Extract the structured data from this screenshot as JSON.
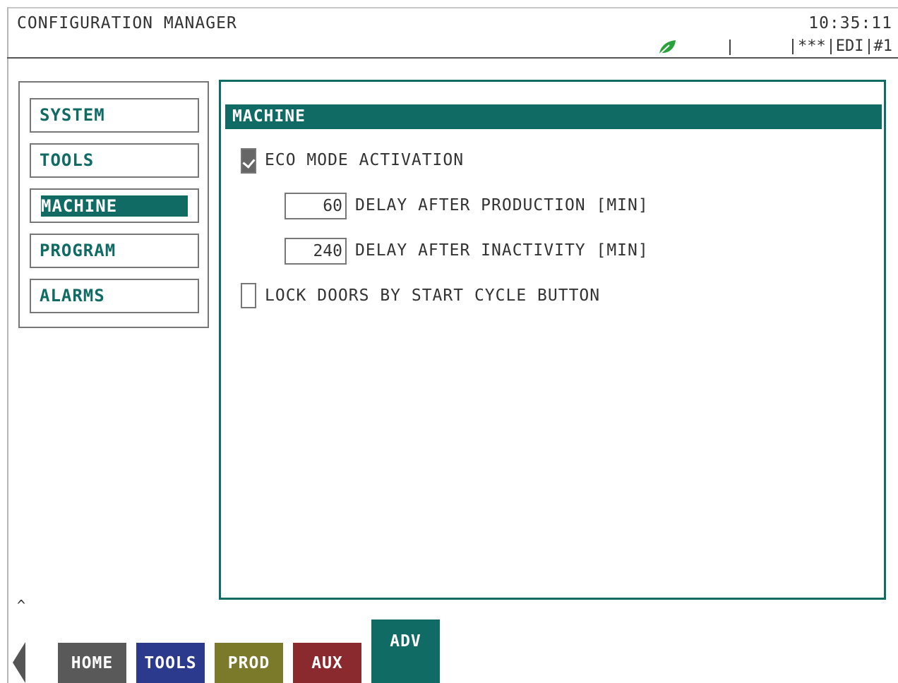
{
  "header": {
    "title": "CONFIGURATION MANAGER",
    "time": "10:35:11",
    "status": [
      "***",
      "EDI",
      "#1"
    ]
  },
  "icons": {
    "eco": "leaf-icon",
    "scroll_up": "caret-up-icon",
    "prev": "left-arrow-icon"
  },
  "sidebar": {
    "items": [
      {
        "label": "SYSTEM"
      },
      {
        "label": "TOOLS"
      },
      {
        "label": "MACHINE",
        "selected": true
      },
      {
        "label": "PROGRAM"
      },
      {
        "label": "ALARMS"
      }
    ]
  },
  "main": {
    "title": "MACHINE",
    "eco_mode": {
      "label": "ECO MODE ACTIVATION",
      "checked": true
    },
    "delay_production": {
      "value": "60",
      "label": "DELAY AFTER PRODUCTION [MIN]"
    },
    "delay_inactivity": {
      "value": "240",
      "label": "DELAY AFTER INACTIVITY [MIN]"
    },
    "lock_doors": {
      "label": "LOCK DOORS BY START CYCLE BUTTON",
      "checked": false
    }
  },
  "bottom_tabs": [
    {
      "label": "HOME",
      "color": "#595959"
    },
    {
      "label": "TOOLS",
      "color": "#2b3a8c"
    },
    {
      "label": "PROD",
      "color": "#7a7a2a"
    },
    {
      "label": "AUX",
      "color": "#8a2a2e"
    },
    {
      "label": "ADV",
      "color": "#0f6b64",
      "active": true
    }
  ],
  "colors": {
    "accent": "#0f6b64",
    "eco_green": "#2aa23a"
  }
}
